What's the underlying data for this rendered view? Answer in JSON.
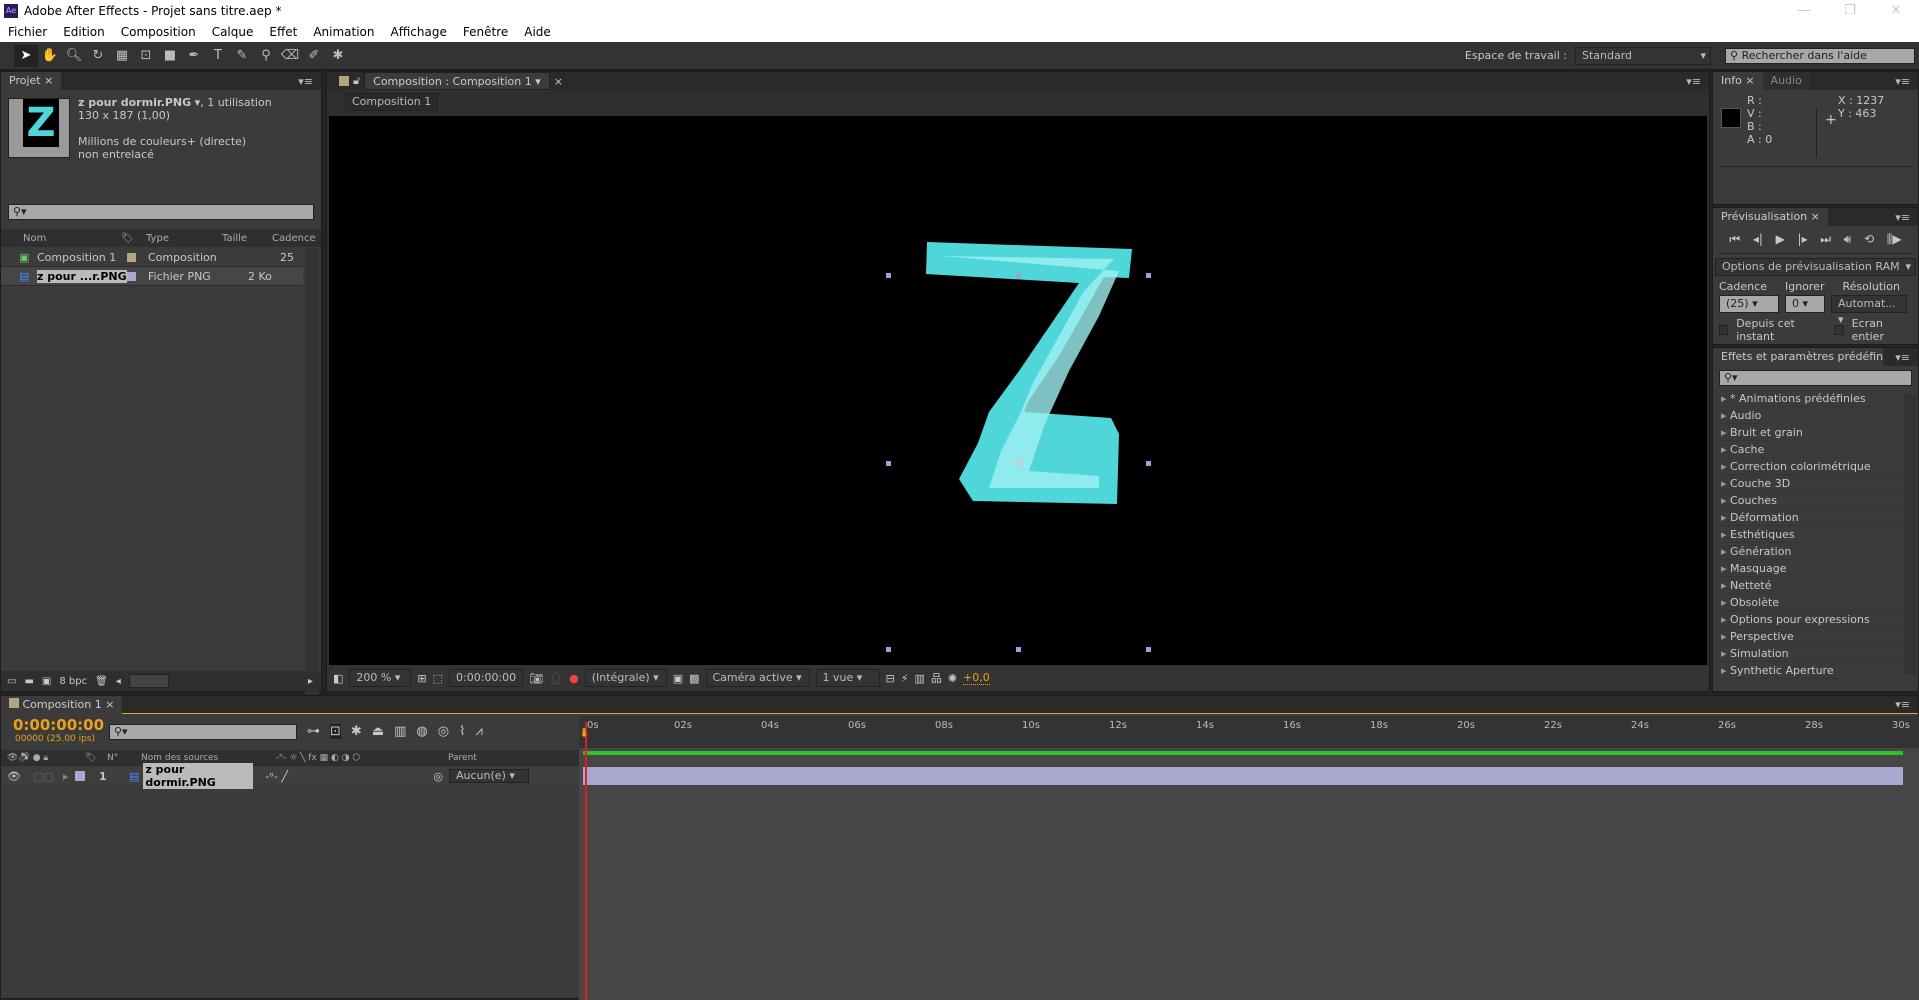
{
  "app": {
    "title": "Adobe After Effects - Projet sans titre.aep *",
    "logo": "Ae"
  },
  "window_controls": [
    "—",
    "❐",
    "✕"
  ],
  "menu": [
    "Fichier",
    "Edition",
    "Composition",
    "Calque",
    "Effet",
    "Animation",
    "Affichage",
    "Fenêtre",
    "Aide"
  ],
  "toolbar": {
    "tools": [
      "selection-tool",
      "hand-tool",
      "zoom-tool",
      "rotate-tool",
      "camera-tool",
      "pan-behind-tool",
      "rectangle-tool",
      "pen-tool",
      "text-tool",
      "brush-tool",
      "clone-stamp-tool",
      "eraser-tool",
      "roto-brush-tool",
      "puppet-pin-tool"
    ],
    "workspace_label": "Espace de travail :",
    "workspace_value": "Standard",
    "help_placeholder": "Rechercher dans l'aide"
  },
  "project": {
    "tab": "Projet",
    "selected_name": "z pour dormir.PNG",
    "usage": ", 1 utilisation",
    "dimensions": "130 x 187 (1,00)",
    "colors": "Millions de couleurs+ (directe)",
    "interlace": "non entrelacé",
    "columns": [
      "Nom",
      "Type",
      "Taille",
      "Cadence"
    ],
    "items": [
      {
        "name": "Composition 1",
        "type": "Composition",
        "size": "",
        "rate": "25",
        "label_color": "#b4a582"
      },
      {
        "name": "z pour ...r.PNG",
        "type": "Fichier PNG",
        "size": "2 Ko",
        "rate": "",
        "label_color": "#a9a9cf"
      }
    ],
    "bpc": "8 bpc"
  },
  "composition": {
    "tab": "Composition : Composition 1",
    "breadcrumb": "Composition 1",
    "zoom": "200 %",
    "timecode": "0:00:00:00",
    "resolution": "(Intégrale)",
    "camera": "Caméra active",
    "views": "1 vue",
    "exposure": "+0,0"
  },
  "info": {
    "tab": "Info",
    "tab2": "Audio",
    "r": "R :",
    "v": "V :",
    "b": "B :",
    "a": "A : 0",
    "x": "X : 1237",
    "y": "Y : 463"
  },
  "preview": {
    "tab": "Prévisualisation",
    "ram_options": "Options de prévisualisation RAM",
    "cadence_label": "Cadence",
    "ignore_label": "Ignorer",
    "resolution_label": "Résolution",
    "cadence": "(25)",
    "ignore": "0",
    "resolution": "Automat...",
    "from_current": "Depuis cet instant",
    "fullscreen": "Ecran entier"
  },
  "effects": {
    "tab": "Effets et paramètres prédéfinis",
    "items": [
      "* Animations prédéfinies",
      "Audio",
      "Bruit et grain",
      "Cache",
      "Correction colorimétrique",
      "Couche 3D",
      "Couches",
      "Déformation",
      "Esthétiques",
      "Génération",
      "Masquage",
      "Netteté",
      "Obsolète",
      "Options pour expressions",
      "Perspective",
      "Simulation",
      "Synthetic Aperture"
    ]
  },
  "timeline": {
    "tab": "Composition 1",
    "timecode": "0:00:00:00",
    "frames": "00000 (25.00 ips)",
    "col_num": "N°",
    "col_source": "Nom des sources",
    "col_parent": "Parent",
    "ticks": [
      "0s",
      "02s",
      "04s",
      "06s",
      "08s",
      "10s",
      "12s",
      "14s",
      "16s",
      "18s",
      "20s",
      "22s",
      "24s",
      "26s",
      "28s",
      "30s"
    ],
    "layers": [
      {
        "index": "1",
        "name": "z pour dormir.PNG",
        "parent": "Aucun(e)"
      }
    ]
  },
  "colors": {
    "accent": "#e8a317",
    "playhead": "#e02020",
    "work_area": "#29c729",
    "layer_bar": "#a9a9cf",
    "z_color": "#4fd6d9"
  }
}
